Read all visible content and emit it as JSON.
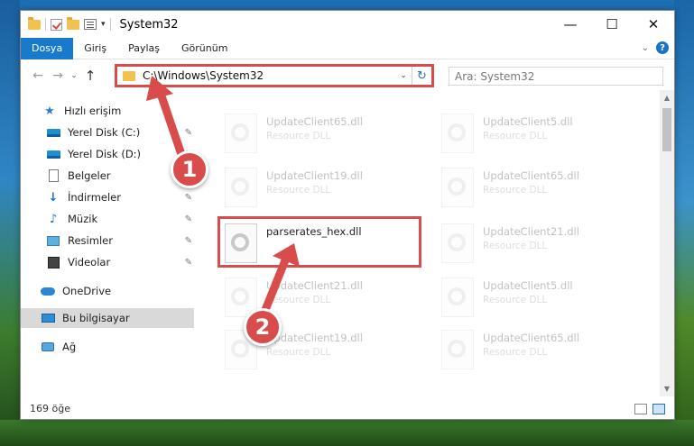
{
  "window": {
    "title": "System32",
    "controls": {
      "minimize": "—",
      "maximize": "☐",
      "close": "✕"
    }
  },
  "ribbon": {
    "tabs": [
      "Dosya",
      "Giriş",
      "Paylaş",
      "Görünüm"
    ],
    "help": "?"
  },
  "nav": {
    "back": "←",
    "forward": "→",
    "recent": "⌄",
    "up": "↑",
    "address": "C:\\Windows\\System32",
    "refresh": "↻",
    "search_placeholder": "Ara: System32"
  },
  "sidebar": {
    "items": [
      {
        "label": "Hızlı erişim",
        "icon": "star-icon",
        "pinned": false
      },
      {
        "label": "Yerel Disk (C:)",
        "icon": "drive-icon",
        "pinned": true
      },
      {
        "label": "Yerel Disk (D:)",
        "icon": "drive-icon",
        "pinned": true
      },
      {
        "label": "Belgeler",
        "icon": "documents-icon",
        "pinned": true
      },
      {
        "label": "İndirmeler",
        "icon": "downloads-icon",
        "pinned": true
      },
      {
        "label": "Müzik",
        "icon": "music-icon",
        "pinned": true
      },
      {
        "label": "Resimler",
        "icon": "pictures-icon",
        "pinned": true
      },
      {
        "label": "Videolar",
        "icon": "videos-icon",
        "pinned": true
      },
      {
        "label": "OneDrive",
        "icon": "onedrive-icon",
        "pinned": false
      },
      {
        "label": "Bu bilgisayar",
        "icon": "this-pc-icon",
        "pinned": false,
        "selected": true
      },
      {
        "label": "Ağ",
        "icon": "network-icon",
        "pinned": false
      }
    ]
  },
  "files": {
    "left_column": [
      {
        "name": "UpdateClient65.dll",
        "type": "Resource DLL",
        "faded": true
      },
      {
        "name": "UpdateClient19.dll",
        "type": "Resource DLL",
        "faded": true
      },
      {
        "name": "parserates_hex.dll",
        "type": "",
        "faded": false,
        "highlighted": true
      },
      {
        "name": "UpdateClient21.dll",
        "type": "Resource DLL",
        "faded": true
      },
      {
        "name": "UpdateClient19.dll",
        "type": "Resource DLL",
        "faded": true
      }
    ],
    "right_column": [
      {
        "name": "UpdateClient5.dll",
        "type": "Resource DLL",
        "faded": true
      },
      {
        "name": "UpdateClient65.dll",
        "type": "Resource DLL",
        "faded": true
      },
      {
        "name": "UpdateClient21.dll",
        "type": "Resource DLL",
        "faded": true
      },
      {
        "name": "UpdateClient5.dll",
        "type": "Resource DLL",
        "faded": true
      },
      {
        "name": "UpdateClient65.dll",
        "type": "Resource DLL",
        "faded": true
      }
    ]
  },
  "status": {
    "count": "169 öğe"
  },
  "annotations": {
    "badge1": "1",
    "badge2": "2",
    "color": "#d94c4c"
  },
  "colors": {
    "accent": "#1979ca",
    "highlight": "#d94c4c"
  }
}
